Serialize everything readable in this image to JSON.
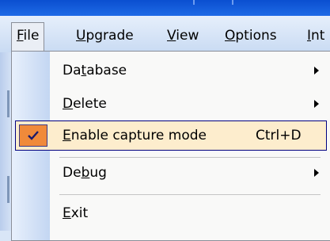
{
  "menubar": {
    "items": [
      {
        "name": "File",
        "hotkey": "F",
        "rest": "ile"
      },
      {
        "name": "Upgrade",
        "hotkey": "U",
        "rest": "pgrade"
      },
      {
        "name": "View",
        "hotkey": "V",
        "rest": "iew"
      },
      {
        "name": "Options",
        "hotkey": "O",
        "rest": "ptions"
      },
      {
        "name": "Int",
        "hotkey": "I",
        "rest": "nt"
      }
    ]
  },
  "file_menu": {
    "items": [
      {
        "pre": "Da",
        "hotkey": "t",
        "post": "abase",
        "has_submenu": true
      },
      {
        "pre": "",
        "hotkey": "D",
        "post": "elete",
        "has_submenu": true
      },
      {
        "pre": "",
        "hotkey": "E",
        "post": "nable capture mode",
        "shortcut": "Ctrl+D",
        "checked": true,
        "highlighted": true
      },
      {
        "pre": "De",
        "hotkey": "b",
        "post": "ug",
        "has_submenu": true
      },
      {
        "pre": "",
        "hotkey": "E",
        "post": "xit"
      }
    ]
  },
  "colors": {
    "titlebar": "#0a4fd0",
    "highlight_bg": "#fdedcd",
    "check_bg": "#f08a3a"
  },
  "icons": {
    "checkmark": "checkmark-icon",
    "submenu_arrow": "chevron-right-icon"
  }
}
